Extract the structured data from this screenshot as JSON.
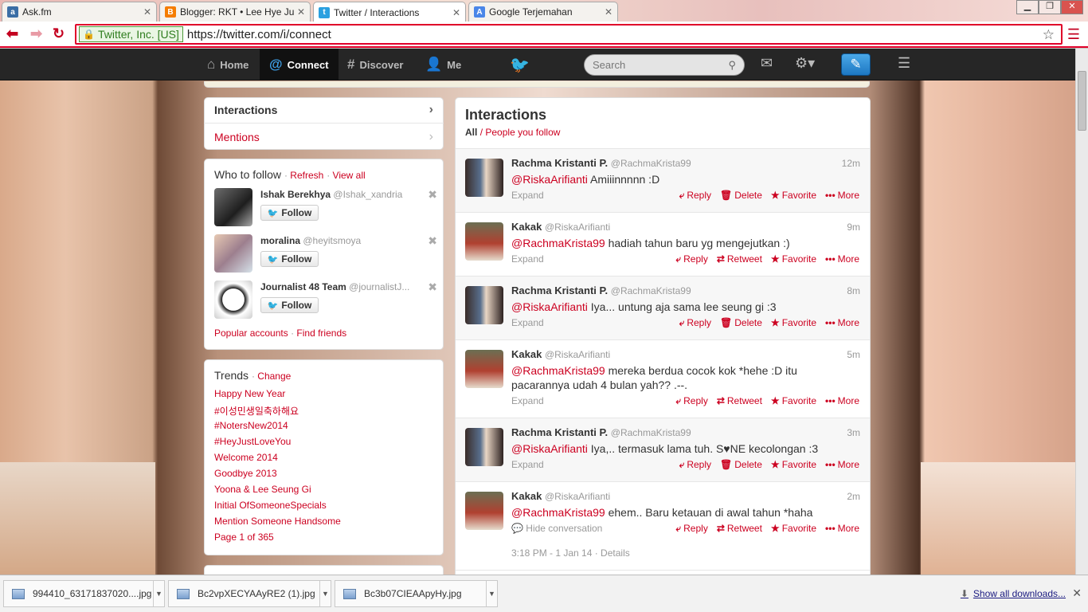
{
  "browser": {
    "tabs": [
      {
        "title": "Ask.fm",
        "icon": "askfm-icon",
        "color": "#3b6ea5"
      },
      {
        "title": "Blogger: RKT • Lee Hye Ju",
        "icon": "blogger-icon",
        "color": "#f57d00"
      },
      {
        "title": "Twitter / Interactions",
        "icon": "twitter-icon",
        "color": "#2ba0e0"
      },
      {
        "title": "Google Terjemahan",
        "icon": "google-translate-icon",
        "color": "#4a86e8"
      }
    ],
    "security_label": "Twitter, Inc. [US]",
    "url": "https://twitter.com/i/connect"
  },
  "topbar": {
    "home": "Home",
    "connect": "Connect",
    "discover": "Discover",
    "me": "Me",
    "search_placeholder": "Search"
  },
  "leftnav": {
    "interactions": "Interactions",
    "mentions": "Mentions"
  },
  "who_to_follow": {
    "title": "Who to follow",
    "refresh": "Refresh",
    "view_all": "View all",
    "follow_label": "Follow",
    "users": [
      {
        "name": "Ishak Berekhya",
        "handle": "@Ishak_xandria"
      },
      {
        "name": "moralina",
        "handle": "@heyitsmoya"
      },
      {
        "name": "Journalist 48 Team",
        "handle": "@journalistJ..."
      }
    ],
    "popular": "Popular accounts",
    "find_friends": "Find friends"
  },
  "trends": {
    "title": "Trends",
    "change": "Change",
    "items": [
      "Happy New Year",
      "#이성민생일축하해요",
      "#NotersNew2014",
      "#HeyJustLoveYou",
      "Welcome 2014",
      "Goodbye 2013",
      "Yoona & Lee Seung Gi",
      "Initial OfSomeoneSpecials",
      "Mention Someone Handsome",
      "Page 1 of 365"
    ]
  },
  "main": {
    "title": "Interactions",
    "filter_all": "All",
    "filter_sep": "/",
    "filter_follow": "People you follow"
  },
  "labels": {
    "expand": "Expand",
    "reply": "Reply",
    "delete": "Delete",
    "retweet": "Retweet",
    "favorite": "Favorite",
    "more": "More",
    "hide": "Hide conversation"
  },
  "tweets": [
    {
      "name": "Rachma Kristanti P.",
      "handle": "@RachmaKrista99",
      "time": "12m",
      "mention": "@RiskaArifianti",
      "text": " Amiiinnnnn :D",
      "own": true
    },
    {
      "name": "Kakak",
      "handle": "@RiskaArifianti",
      "time": "9m",
      "mention": "@RachmaKrista99",
      "text": " hadiah tahun baru yg mengejutkan :)",
      "own": false
    },
    {
      "name": "Rachma Kristanti P.",
      "handle": "@RachmaKrista99",
      "time": "8m",
      "mention": "@RiskaArifianti",
      "text": " Iya... untung aja sama lee seung gi :3",
      "own": true
    },
    {
      "name": "Kakak",
      "handle": "@RiskaArifianti",
      "time": "5m",
      "mention": "@RachmaKrista99",
      "text": " mereka berdua cocok kok *hehe :D itu pacarannya udah 4 bulan yah?? .--.",
      "own": false
    },
    {
      "name": "Rachma Kristanti P.",
      "handle": "@RachmaKrista99",
      "time": "3m",
      "mention": "@RiskaArifianti",
      "text": " Iya,.. termasuk lama tuh. S♥NE kecolongan :3",
      "own": true
    },
    {
      "name": "Kakak",
      "handle": "@RiskaArifianti",
      "time": "2m",
      "mention": "@RachmaKrista99",
      "text": " ehem.. Baru ketauan di awal tahun *haha",
      "own": false
    }
  ],
  "last_meta": "3:18 PM - 1 Jan 14 · Details",
  "downloads": {
    "files": [
      "994410_63171837020....jpg",
      "Bc2vpXECYAAyRE2 (1).jpg",
      "Bc3b07CIEAApyHy.jpg"
    ],
    "show_all": "Show all downloads..."
  }
}
